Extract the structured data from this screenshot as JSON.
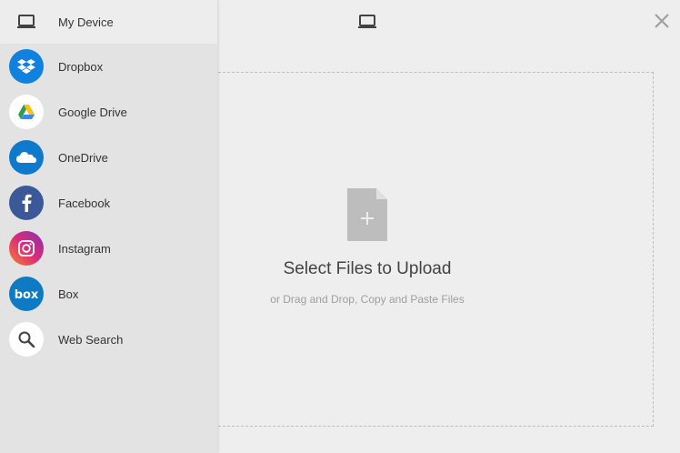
{
  "sidebar": {
    "items": [
      {
        "label": "My Device",
        "icon": "laptop-icon",
        "color": "transparent"
      },
      {
        "label": "Dropbox",
        "icon": "dropbox-icon",
        "color": "#1081de"
      },
      {
        "label": "Google Drive",
        "icon": "google-drive-icon",
        "color": "#ffffff"
      },
      {
        "label": "OneDrive",
        "icon": "onedrive-icon",
        "color": "#0f7acc"
      },
      {
        "label": "Facebook",
        "icon": "facebook-icon",
        "color": "#3b5998"
      },
      {
        "label": "Instagram",
        "icon": "instagram-icon",
        "color": "#d62976"
      },
      {
        "label": "Box",
        "icon": "box-icon",
        "color": "#0f7ac4"
      },
      {
        "label": "Web Search",
        "icon": "search-icon",
        "color": "#ffffff"
      }
    ]
  },
  "main": {
    "title": "Select Files to Upload",
    "subtitle": "or Drag and Drop, Copy and Paste Files"
  }
}
